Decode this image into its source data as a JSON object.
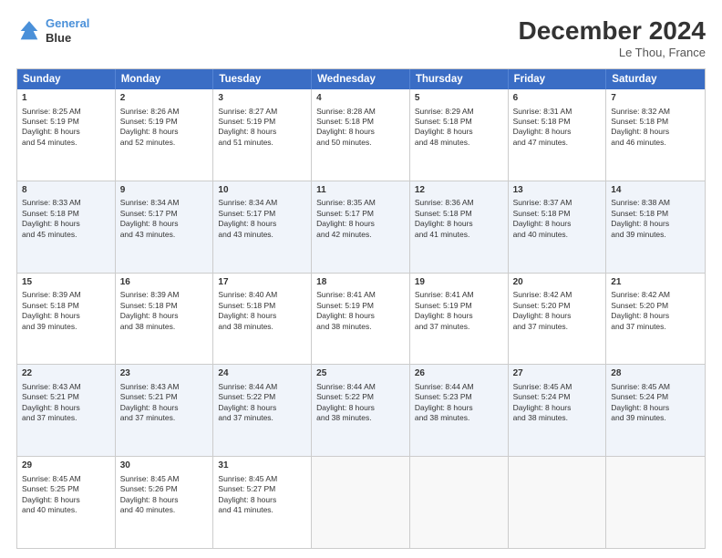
{
  "header": {
    "logo_line1": "General",
    "logo_line2": "Blue",
    "month_title": "December 2024",
    "location": "Le Thou, France"
  },
  "weekdays": [
    "Sunday",
    "Monday",
    "Tuesday",
    "Wednesday",
    "Thursday",
    "Friday",
    "Saturday"
  ],
  "rows": [
    [
      {
        "day": "1",
        "lines": [
          "Sunrise: 8:25 AM",
          "Sunset: 5:19 PM",
          "Daylight: 8 hours",
          "and 54 minutes."
        ]
      },
      {
        "day": "2",
        "lines": [
          "Sunrise: 8:26 AM",
          "Sunset: 5:19 PM",
          "Daylight: 8 hours",
          "and 52 minutes."
        ]
      },
      {
        "day": "3",
        "lines": [
          "Sunrise: 8:27 AM",
          "Sunset: 5:19 PM",
          "Daylight: 8 hours",
          "and 51 minutes."
        ]
      },
      {
        "day": "4",
        "lines": [
          "Sunrise: 8:28 AM",
          "Sunset: 5:18 PM",
          "Daylight: 8 hours",
          "and 50 minutes."
        ]
      },
      {
        "day": "5",
        "lines": [
          "Sunrise: 8:29 AM",
          "Sunset: 5:18 PM",
          "Daylight: 8 hours",
          "and 48 minutes."
        ]
      },
      {
        "day": "6",
        "lines": [
          "Sunrise: 8:31 AM",
          "Sunset: 5:18 PM",
          "Daylight: 8 hours",
          "and 47 minutes."
        ]
      },
      {
        "day": "7",
        "lines": [
          "Sunrise: 8:32 AM",
          "Sunset: 5:18 PM",
          "Daylight: 8 hours",
          "and 46 minutes."
        ]
      }
    ],
    [
      {
        "day": "8",
        "lines": [
          "Sunrise: 8:33 AM",
          "Sunset: 5:18 PM",
          "Daylight: 8 hours",
          "and 45 minutes."
        ]
      },
      {
        "day": "9",
        "lines": [
          "Sunrise: 8:34 AM",
          "Sunset: 5:17 PM",
          "Daylight: 8 hours",
          "and 43 minutes."
        ]
      },
      {
        "day": "10",
        "lines": [
          "Sunrise: 8:34 AM",
          "Sunset: 5:17 PM",
          "Daylight: 8 hours",
          "and 43 minutes."
        ]
      },
      {
        "day": "11",
        "lines": [
          "Sunrise: 8:35 AM",
          "Sunset: 5:17 PM",
          "Daylight: 8 hours",
          "and 42 minutes."
        ]
      },
      {
        "day": "12",
        "lines": [
          "Sunrise: 8:36 AM",
          "Sunset: 5:18 PM",
          "Daylight: 8 hours",
          "and 41 minutes."
        ]
      },
      {
        "day": "13",
        "lines": [
          "Sunrise: 8:37 AM",
          "Sunset: 5:18 PM",
          "Daylight: 8 hours",
          "and 40 minutes."
        ]
      },
      {
        "day": "14",
        "lines": [
          "Sunrise: 8:38 AM",
          "Sunset: 5:18 PM",
          "Daylight: 8 hours",
          "and 39 minutes."
        ]
      }
    ],
    [
      {
        "day": "15",
        "lines": [
          "Sunrise: 8:39 AM",
          "Sunset: 5:18 PM",
          "Daylight: 8 hours",
          "and 39 minutes."
        ]
      },
      {
        "day": "16",
        "lines": [
          "Sunrise: 8:39 AM",
          "Sunset: 5:18 PM",
          "Daylight: 8 hours",
          "and 38 minutes."
        ]
      },
      {
        "day": "17",
        "lines": [
          "Sunrise: 8:40 AM",
          "Sunset: 5:18 PM",
          "Daylight: 8 hours",
          "and 38 minutes."
        ]
      },
      {
        "day": "18",
        "lines": [
          "Sunrise: 8:41 AM",
          "Sunset: 5:19 PM",
          "Daylight: 8 hours",
          "and 38 minutes."
        ]
      },
      {
        "day": "19",
        "lines": [
          "Sunrise: 8:41 AM",
          "Sunset: 5:19 PM",
          "Daylight: 8 hours",
          "and 37 minutes."
        ]
      },
      {
        "day": "20",
        "lines": [
          "Sunrise: 8:42 AM",
          "Sunset: 5:20 PM",
          "Daylight: 8 hours",
          "and 37 minutes."
        ]
      },
      {
        "day": "21",
        "lines": [
          "Sunrise: 8:42 AM",
          "Sunset: 5:20 PM",
          "Daylight: 8 hours",
          "and 37 minutes."
        ]
      }
    ],
    [
      {
        "day": "22",
        "lines": [
          "Sunrise: 8:43 AM",
          "Sunset: 5:21 PM",
          "Daylight: 8 hours",
          "and 37 minutes."
        ]
      },
      {
        "day": "23",
        "lines": [
          "Sunrise: 8:43 AM",
          "Sunset: 5:21 PM",
          "Daylight: 8 hours",
          "and 37 minutes."
        ]
      },
      {
        "day": "24",
        "lines": [
          "Sunrise: 8:44 AM",
          "Sunset: 5:22 PM",
          "Daylight: 8 hours",
          "and 37 minutes."
        ]
      },
      {
        "day": "25",
        "lines": [
          "Sunrise: 8:44 AM",
          "Sunset: 5:22 PM",
          "Daylight: 8 hours",
          "and 38 minutes."
        ]
      },
      {
        "day": "26",
        "lines": [
          "Sunrise: 8:44 AM",
          "Sunset: 5:23 PM",
          "Daylight: 8 hours",
          "and 38 minutes."
        ]
      },
      {
        "day": "27",
        "lines": [
          "Sunrise: 8:45 AM",
          "Sunset: 5:24 PM",
          "Daylight: 8 hours",
          "and 38 minutes."
        ]
      },
      {
        "day": "28",
        "lines": [
          "Sunrise: 8:45 AM",
          "Sunset: 5:24 PM",
          "Daylight: 8 hours",
          "and 39 minutes."
        ]
      }
    ],
    [
      {
        "day": "29",
        "lines": [
          "Sunrise: 8:45 AM",
          "Sunset: 5:25 PM",
          "Daylight: 8 hours",
          "and 40 minutes."
        ]
      },
      {
        "day": "30",
        "lines": [
          "Sunrise: 8:45 AM",
          "Sunset: 5:26 PM",
          "Daylight: 8 hours",
          "and 40 minutes."
        ]
      },
      {
        "day": "31",
        "lines": [
          "Sunrise: 8:45 AM",
          "Sunset: 5:27 PM",
          "Daylight: 8 hours",
          "and 41 minutes."
        ]
      },
      null,
      null,
      null,
      null
    ]
  ]
}
